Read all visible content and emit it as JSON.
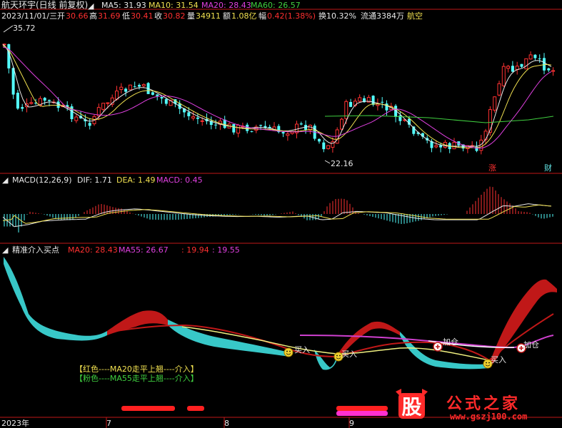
{
  "header": {
    "title": "航天环宇(日线 前复权)",
    "ma5": "MA5: 31.93",
    "ma10": "MA10: 31.54",
    "ma20": "MA20: 28.43",
    "ma60": "MA60: 26.57",
    "date": "2023/11/01/三",
    "open_label": "开",
    "open": "30.66",
    "high_label": "高",
    "high": "31.69",
    "low_label": "低",
    "low": "30.41",
    "close_label": "收",
    "close": "30.82",
    "vol_label": "量",
    "vol": "34911",
    "amt_label": "额",
    "amt": "1.08亿",
    "chg_label": "幅",
    "chg": "0.42(1.38%)",
    "turnover": "换10.32%",
    "float": "流通3384万",
    "sector": "航空",
    "max_price": "35.72",
    "min_price": "22.16",
    "tag_zhang": "涨",
    "tag_cai": "财"
  },
  "macd_panel": {
    "name": "MACD(12,26,9)",
    "dif": "DIF: 1.71",
    "dea": "DEA: 1.49",
    "macd": "MACD: 0.45"
  },
  "indicator_panel": {
    "name": "精准介入买点",
    "ma20": "MA20: 28.43",
    "ma55": "MA55: 26.67",
    "v1": ": 19.94",
    "v2": ": 19.55",
    "legend_red": "【红色----MA20走平上翘----介入】",
    "legend_pink": "【粉色----MA55走平上翘----介入】",
    "signals": [
      {
        "label": "买入"
      },
      {
        "label": "买入"
      },
      {
        "label": "加仓"
      },
      {
        "label": "买入"
      },
      {
        "label": "加仓"
      }
    ]
  },
  "axis": {
    "year": "2023年",
    "months": [
      "7",
      "8",
      "9"
    ]
  },
  "watermark": {
    "logo_char": "股",
    "text": "公式之家",
    "url": "www.gszj100.com"
  },
  "colors": {
    "background": "#000000",
    "up": "#ff3232",
    "down": "#54ffff",
    "ma5": "#e8e8e8",
    "ma10": "#f0e050",
    "ma20": "#e040e0",
    "ma60": "#40d040",
    "grid": "#b01010"
  }
}
